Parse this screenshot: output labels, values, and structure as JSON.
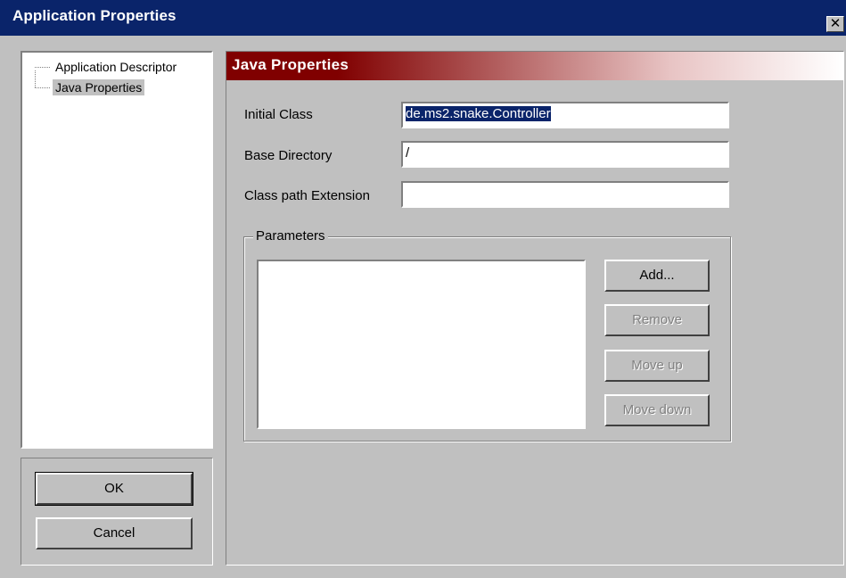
{
  "window": {
    "title": "Application Properties",
    "close_glyph": "✕"
  },
  "tree": {
    "items": [
      {
        "label": "Application Descriptor",
        "selected": false
      },
      {
        "label": "Java Properties",
        "selected": true
      }
    ]
  },
  "buttons": {
    "ok": "OK",
    "cancel": "Cancel"
  },
  "panel": {
    "header": "Java Properties",
    "fields": {
      "initial_class": {
        "label": "Initial Class",
        "value": "de.ms2.snake.Controller"
      },
      "base_directory": {
        "label": "Base Directory",
        "value": "/"
      },
      "class_path_extension": {
        "label": "Class path Extension",
        "value": ""
      }
    },
    "parameters": {
      "legend": "Parameters",
      "items": [],
      "add": "Add...",
      "remove": "Remove",
      "move_up": "Move up",
      "move_down": "Move down"
    }
  },
  "colors": {
    "titlebar": "#0a246a",
    "header_gradient_start": "#800000",
    "face": "#c0c0c0"
  }
}
